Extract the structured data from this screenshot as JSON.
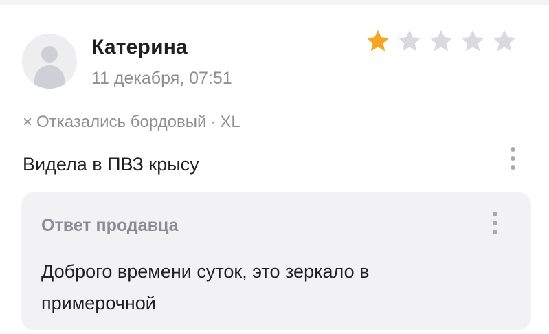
{
  "review": {
    "author": "Катерина",
    "date": "11 декабря, 07:51",
    "rating": 1,
    "max_rating": 5,
    "status_icon": "cross-icon",
    "status": "Отказались",
    "color": "бордовый",
    "separator": "·",
    "size": "XL",
    "text": "Видела в ПВЗ крысу"
  },
  "seller_reply": {
    "title": "Ответ продавца",
    "text": "Доброго времени суток, это зеркало в примерочной"
  },
  "colors": {
    "star_filled": "#f5a623",
    "star_empty": "#d9d9de",
    "reply_bg": "#f2f2f5"
  }
}
